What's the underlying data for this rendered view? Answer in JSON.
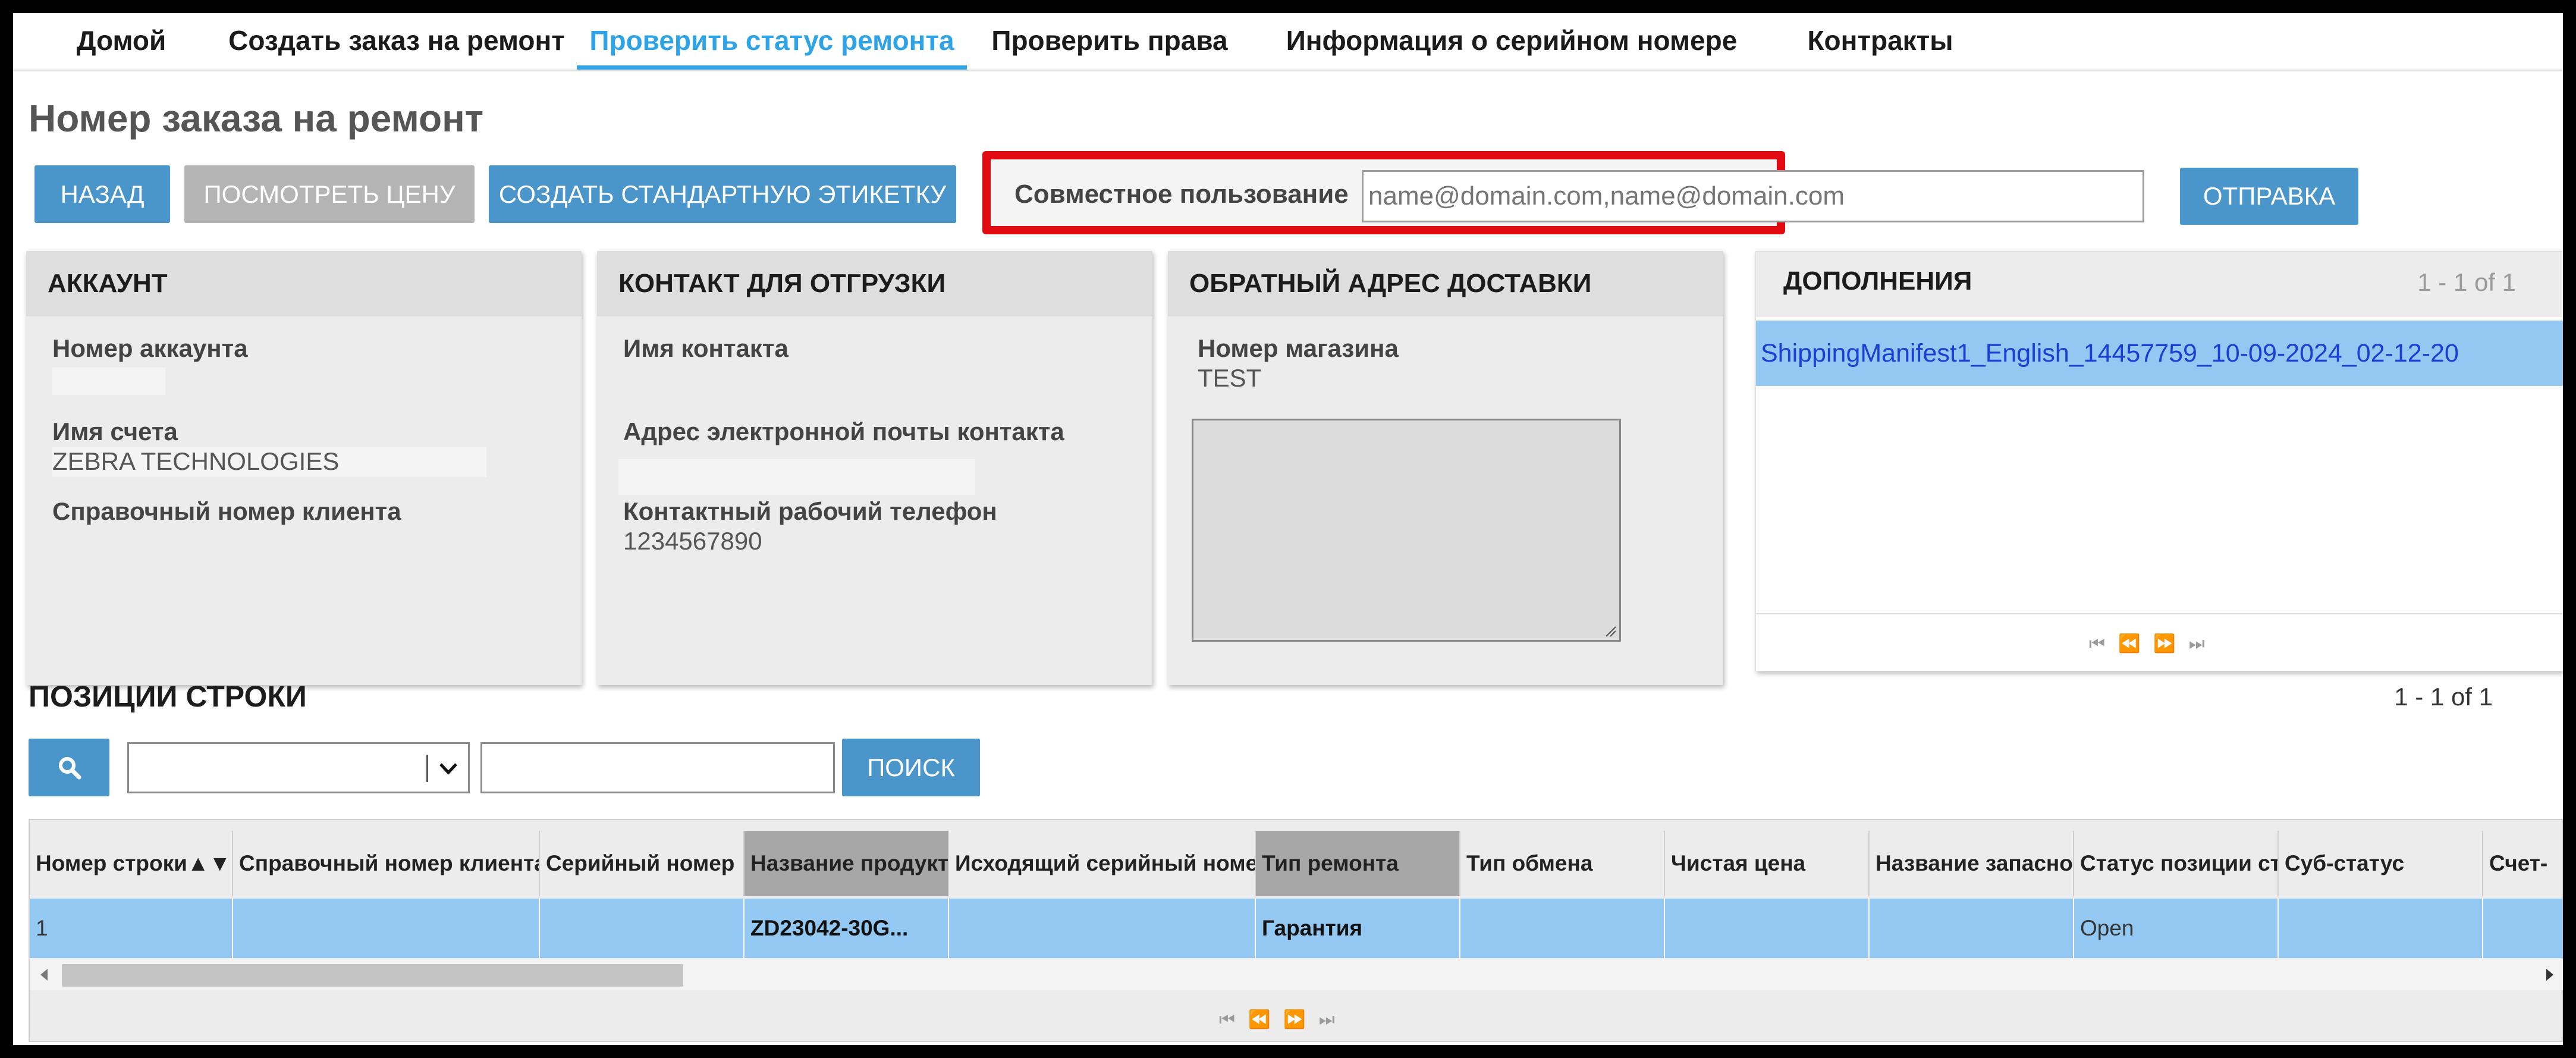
{
  "nav": {
    "items": [
      {
        "label": "Домой"
      },
      {
        "label": "Создать заказ на ремонт"
      },
      {
        "label": "Проверить статус ремонта"
      },
      {
        "label": "Проверить права"
      },
      {
        "label": "Информация о серийном номере"
      },
      {
        "label": "Контракты"
      }
    ],
    "active_index": 2
  },
  "page_title": "Номер заказа на ремонт",
  "toolbar": {
    "back": "НАЗАД",
    "view_price": "ПОСМОТРЕТЬ ЦЕНУ",
    "create_label": "СОЗДАТЬ СТАНДАРТНУЮ ЭТИКЕТКУ"
  },
  "share": {
    "label": "Совместное пользование",
    "placeholder": "name@domain.com,name@domain.com",
    "submit": "ОТПРАВКА"
  },
  "account": {
    "title": "АККАУНТ",
    "number_label": "Номер аккаунта",
    "name_label": "Имя счета",
    "name_value": "ZEBRA TECHNOLOGIES",
    "ref_label": "Справочный номер клиента"
  },
  "shipping_contact": {
    "title": "КОНТАКТ ДЛЯ ОТГРУЗКИ",
    "name_label": "Имя контакта",
    "email_label": "Адрес электронной почты контакта",
    "phone_label": "Контактный рабочий телефон",
    "phone_value": "1234567890"
  },
  "return_address": {
    "title": "ОБРАТНЫЙ АДРЕС ДОСТАВКИ",
    "store_label": "Номер магазина",
    "store_value": "TEST"
  },
  "addons": {
    "title": "ДОПОЛНЕНИЯ",
    "count": "1 - 1 of 1",
    "items": [
      "ShippingManifest1_English_14457759_10-09-2024_02-12-20"
    ],
    "pager": "⏮⏪⏩⏭"
  },
  "line_items": {
    "title": "ПОЗИЦИИ СТРОКИ",
    "count": "1 - 1 of 1",
    "search_button": "ПОИСК",
    "columns": [
      "Номер строки▲▼",
      "Справочный номер клиента",
      "Серийный номер",
      "Название продукта",
      "Исходящий серийный номер",
      "Тип ремонта",
      "Тип обмена",
      "Чистая цена",
      "Название запасной",
      "Статус позиции строки",
      "Суб-статус",
      "Счет-"
    ],
    "rows": [
      [
        "1",
        "",
        "",
        "ZD23042-30G...",
        "",
        "Гарантия",
        "",
        "",
        "",
        "Open",
        "",
        ""
      ]
    ]
  },
  "colors": {
    "accent": "#2ea3e6",
    "button": "#4a95c9",
    "highlight": "#e00a10",
    "row_selected": "#93c8f2"
  }
}
